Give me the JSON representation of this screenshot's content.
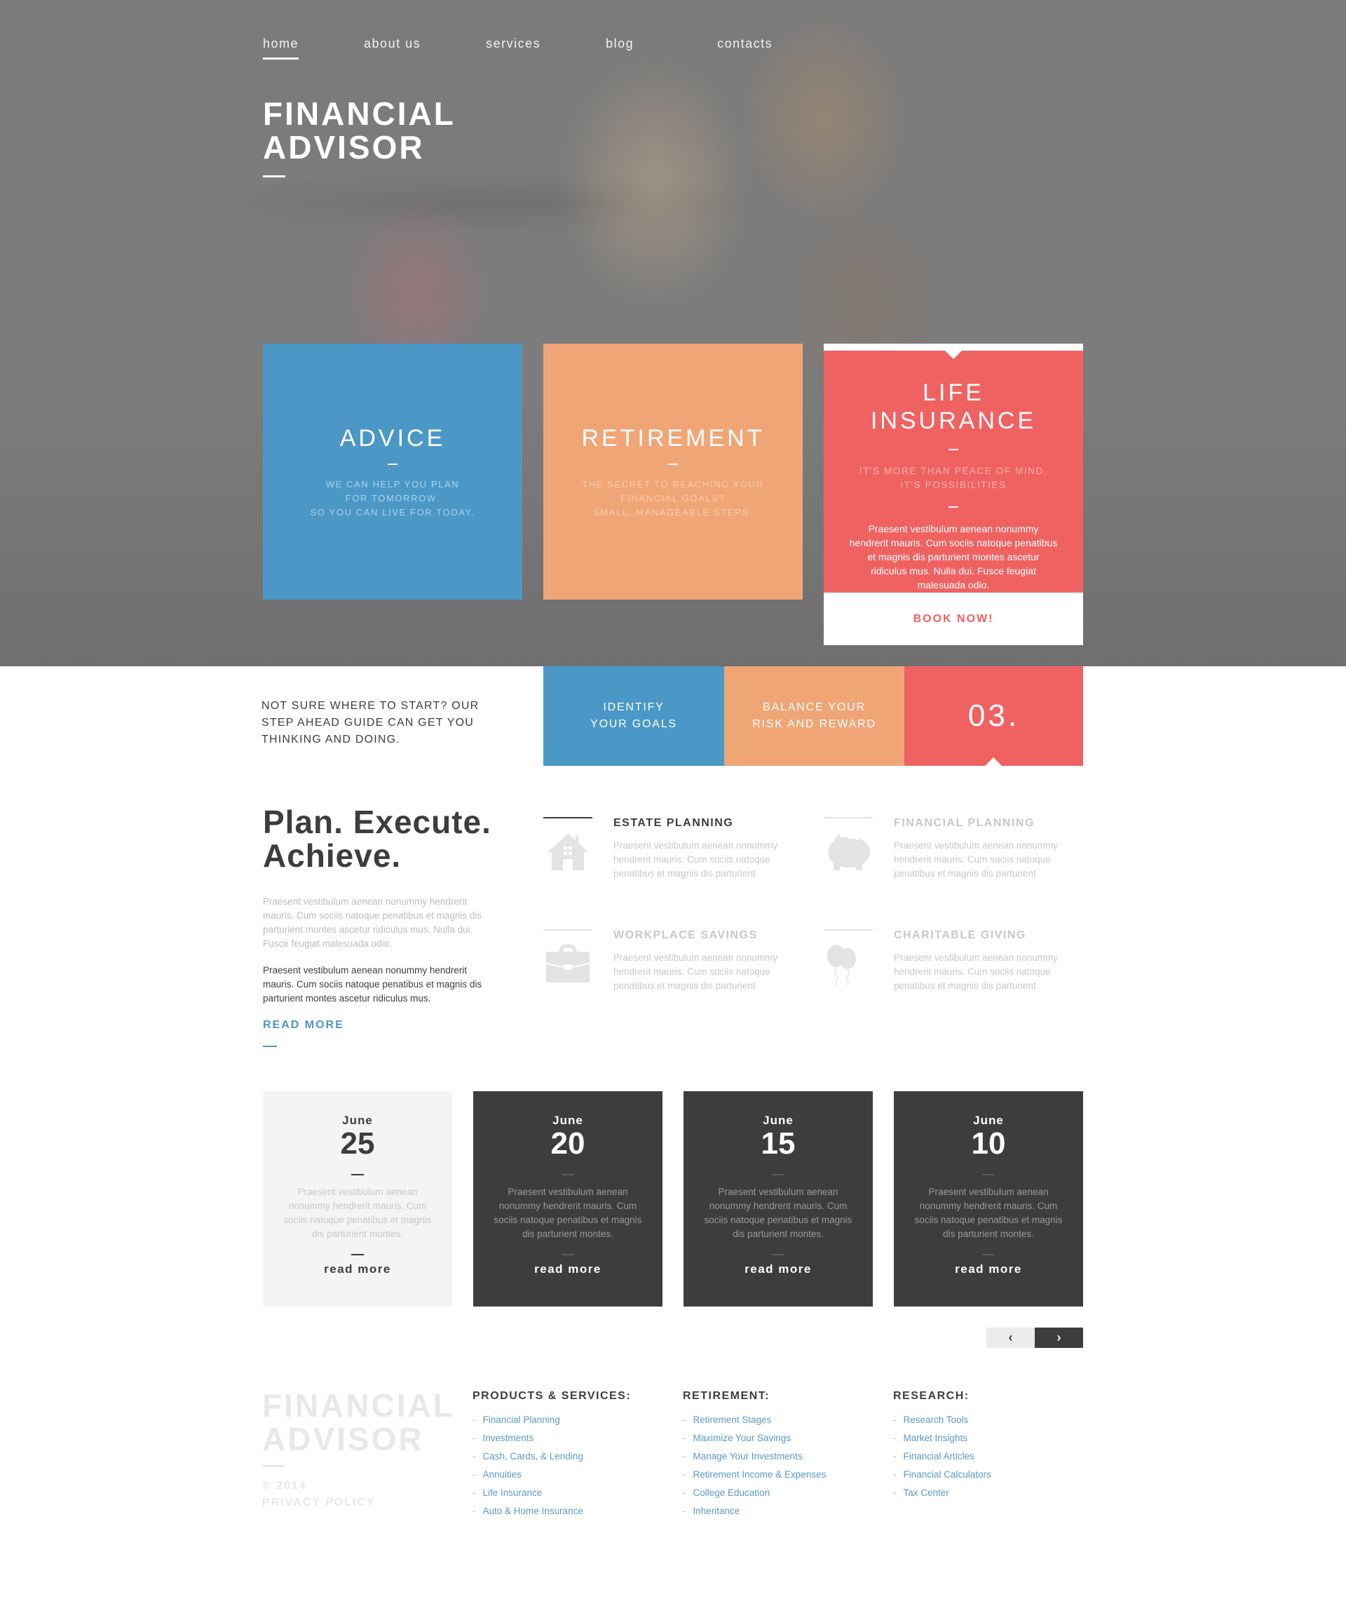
{
  "nav": {
    "items": [
      {
        "label": "home",
        "active": true
      },
      {
        "label": "about us",
        "active": false
      },
      {
        "label": "services",
        "active": false
      },
      {
        "label": "blog",
        "active": false
      },
      {
        "label": "contacts",
        "active": false
      }
    ]
  },
  "hero": {
    "title_line1": "FINANCIAL",
    "title_line2": "ADVISOR"
  },
  "tiles": {
    "advice": {
      "title": "ADVICE",
      "lines": [
        "WE CAN HELP YOU PLAN",
        "FOR TOMORROW.",
        "SO YOU CAN LIVE FOR TODAY."
      ]
    },
    "retirement": {
      "title": "RETIREMENT",
      "lines": [
        "THE SECRET TO REACHING YOUR",
        "FINANCIAL GOALS?",
        "SMALL, MANAGEABLE STEPS."
      ]
    },
    "life_insurance": {
      "title_line1": "LIFE",
      "title_line2": "INSURANCE",
      "sub_line1": "IT'S MORE THAN PEACE OF MIND.",
      "sub_line2": "IT'S POSSIBILITIES",
      "body": "Praesent vestibulum aenean nonummy hendrerit mauris. Cum sociis natoque penatibus et magnis dis parturient montes ascetur ridiculus mus. Nulla dui. Fusce feugiat malesuada odio.",
      "button": "BOOK NOW!"
    }
  },
  "steps": {
    "intro": "NOT SURE WHERE TO START? OUR STEP AHEAD GUIDE CAN GET YOU THINKING AND DOING.",
    "step1_line1": "IDENTIFY",
    "step1_line2": "YOUR GOALS",
    "step2_line1": "BALANCE YOUR",
    "step2_line2": "RISK AND REWARD",
    "step3": "03."
  },
  "plan": {
    "title_line1": "Plan. Execute.",
    "title_line2": "Achieve.",
    "para1": "Praesent vestibulum aenean nonummy hendrerit mauris. Cum sociis natoque penatibus et magnis dis parturient montes ascetur ridiculus mus. Nulla dui. Fusce feugiat malesuada odio.",
    "para2": "Praesent vestibulum aenean nonummy hendrerit mauris. Cum sociis natoque penatibus et magnis dis parturient montes ascetur ridiculus mus.",
    "read_more": "READ MORE"
  },
  "features": [
    {
      "title": "ESTATE PLANNING",
      "icon": "house-icon",
      "text": "Praesent vestibulum aenean nonummy hendrerit mauris. Cum sociis natoque penatibus et magnis dis parturient",
      "active": true
    },
    {
      "title": "FINANCIAL PLANNING",
      "icon": "piggy-bank-icon",
      "text": "Praesent vestibulum aenean nonummy hendrerit mauris. Cum sociis natoque penatibus et magnis dis parturient",
      "active": false
    },
    {
      "title": "WORKPLACE SAVINGS",
      "icon": "briefcase-icon",
      "text": "Praesent vestibulum aenean nonummy hendrerit mauris. Cum sociis natoque penatibus et magnis dis parturient",
      "active": false
    },
    {
      "title": "CHARITABLE GIVING",
      "icon": "balloons-icon",
      "text": "Praesent vestibulum aenean nonummy hendrerit mauris. Cum sociis natoque penatibus et magnis dis parturient",
      "active": false
    }
  ],
  "blog": {
    "cards": [
      {
        "month": "June",
        "day": "25",
        "excerpt": "Praesent vestibulum aenean nonummy hendrerit mauris. Cum sociis natoque penatibus et magnis dis parturient montes.",
        "link": "read more",
        "highlighted": true
      },
      {
        "month": "June",
        "day": "20",
        "excerpt": "Praesent vestibulum aenean nonummy hendrerit mauris. Cum sociis natoque penatibus et magnis dis parturient montes.",
        "link": "read more",
        "highlighted": false
      },
      {
        "month": "June",
        "day": "15",
        "excerpt": "Praesent vestibulum aenean nonummy hendrerit mauris. Cum sociis natoque penatibus et magnis dis parturient montes.",
        "link": "read more",
        "highlighted": false
      },
      {
        "month": "June",
        "day": "10",
        "excerpt": "Praesent vestibulum aenean nonummy hendrerit mauris. Cum sociis natoque penatibus et magnis dis parturient montes.",
        "link": "read more",
        "highlighted": false
      }
    ],
    "prev_icon": "‹",
    "next_icon": "›"
  },
  "footer": {
    "logo_line1": "FINANCIAL",
    "logo_line2": "ADVISOR",
    "copyright": "© 2014",
    "privacy": "PRIVACY POLICY",
    "columns": [
      {
        "heading": "PRODUCTS & SERVICES:",
        "links": [
          "Financial Planning",
          "Investments",
          "Cash, Cards, & Lending",
          "Annuities",
          "Life Insurance",
          "Auto & Home Insurance"
        ]
      },
      {
        "heading": "RETIREMENT:",
        "links": [
          "Retirement Stages",
          "Maximize Your Savings",
          "Manage Your Investments",
          "Retirement Income & Expenses",
          "College Education",
          "Inheritance"
        ]
      },
      {
        "heading": "RESEARCH:",
        "links": [
          "Research Tools",
          "Market Insights",
          "Financial Articles",
          "Financial Calculators",
          "Tax Center"
        ]
      }
    ]
  },
  "colors": {
    "blue": "#4b98c6",
    "orange": "#f0a577",
    "red": "#f06262",
    "dark": "#3d3d3d",
    "hero_overlay": "#7a7a7a"
  }
}
